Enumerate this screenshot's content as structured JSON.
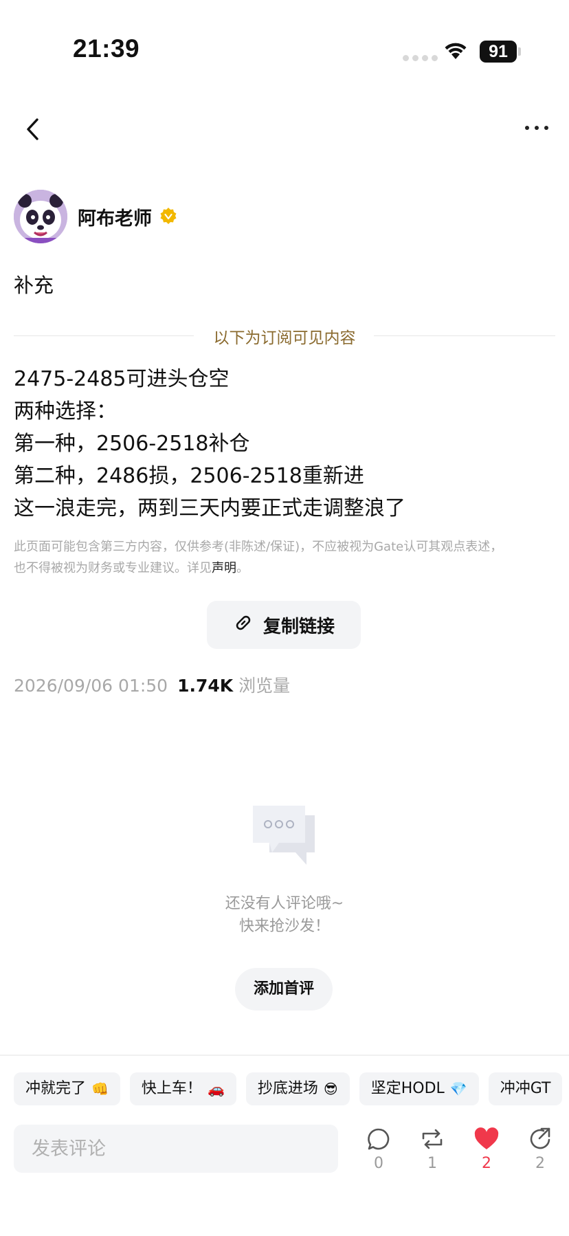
{
  "status_bar": {
    "time": "21:39",
    "battery": "91"
  },
  "author": {
    "name": "阿布老师"
  },
  "post": {
    "title": "补充",
    "subscription_divider": "以下为订阅可见内容",
    "body_lines": [
      "2475-2485可进头仓空",
      "两种选择：",
      "第一种，2506-2518补仓",
      "第二种，2486损，2506-2518重新进",
      "这一浪走完，两到三天内要正式走调整浪了"
    ],
    "disclaimer_line1": "此页面可能包含第三方内容，仅供参考(非陈述/保证)，不应被视为Gate认可其观点表述，",
    "disclaimer_line2_prefix": "也不得被视为财务或专业建议。详见",
    "disclaimer_link": "声明",
    "disclaimer_suffix": "。",
    "copy_link_label": "复制链接",
    "timestamp": "2026/09/06 01:50",
    "views_count": "1.74K",
    "views_label": "浏览量"
  },
  "comments": {
    "empty_line1": "还没有人评论哦~",
    "empty_line2": "快来抢沙发！",
    "add_first_label": "添加首评"
  },
  "quick_replies": [
    {
      "label": "冲就完了",
      "emoji": "👊"
    },
    {
      "label": "快上车！",
      "emoji": "🚗"
    },
    {
      "label": "抄底进场",
      "emoji": "😎"
    },
    {
      "label": "坚定HODL",
      "emoji": "💎"
    },
    {
      "label": "冲冲GT",
      "emoji": ""
    }
  ],
  "comment_input": {
    "placeholder": "发表评论"
  },
  "actions": {
    "comment_count": "0",
    "repost_count": "1",
    "like_count": "2",
    "share_count": "2"
  },
  "colors": {
    "accent_gold": "#8a6a2e",
    "like_red": "#f0384b",
    "verified_gold": "#f2b800"
  }
}
